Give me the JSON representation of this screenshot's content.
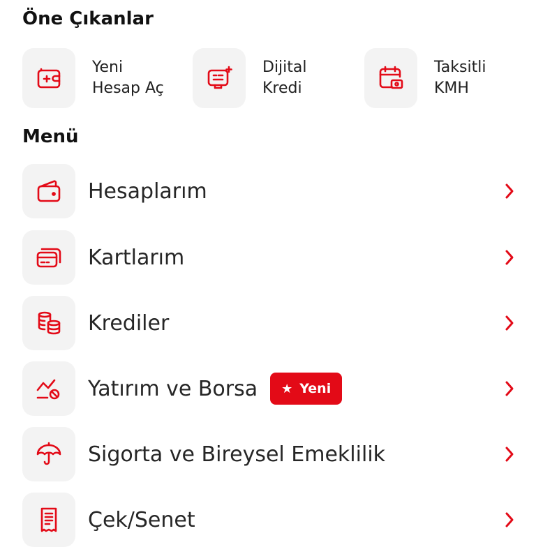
{
  "featured": {
    "title": "Öne Çıkanlar",
    "items": [
      {
        "line1": "Yeni",
        "line2": "Hesap Aç",
        "icon": "wallet-plus-icon"
      },
      {
        "line1": "Dijital",
        "line2": "Kredi",
        "icon": "digital-screen-icon"
      },
      {
        "line1": "Taksitli",
        "line2": "KMH",
        "icon": "calendar-money-icon"
      }
    ]
  },
  "menu": {
    "title": "Menü",
    "items": [
      {
        "label": "Hesaplarım",
        "icon": "wallet-icon"
      },
      {
        "label": "Kartlarım",
        "icon": "cards-icon"
      },
      {
        "label": "Krediler",
        "icon": "coins-icon"
      },
      {
        "label": "Yatırım ve Borsa",
        "icon": "chart-coin-icon",
        "badge": "Yeni"
      },
      {
        "label": "Sigorta ve Bireysel Emeklilik",
        "icon": "umbrella-icon"
      },
      {
        "label": "Çek/Senet",
        "icon": "receipt-icon"
      }
    ]
  },
  "colors": {
    "accent": "#e30a17",
    "tile_bg": "#f3f3f3",
    "text": "#262626"
  }
}
